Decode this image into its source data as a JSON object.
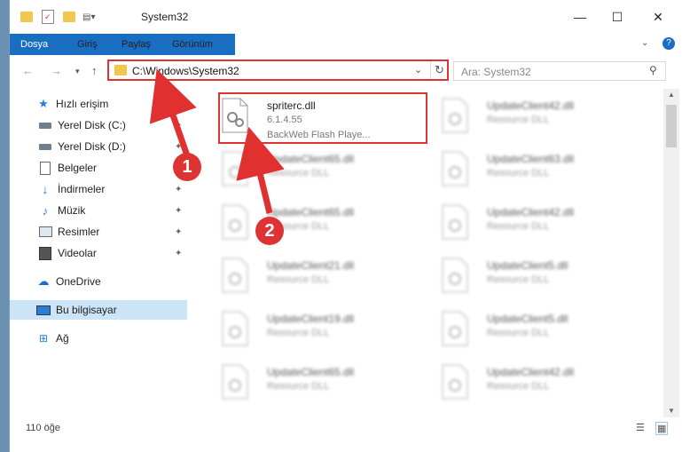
{
  "window": {
    "title": "System32",
    "minimize": "—",
    "maximize": "☐",
    "close": "✕"
  },
  "ribbon": {
    "tabs": [
      "Dosya",
      "Giriş",
      "Paylaş",
      "Görünüm"
    ]
  },
  "address": {
    "path": "C:\\Windows\\System32"
  },
  "search": {
    "placeholder": "Ara: System32"
  },
  "sidebar": {
    "items": [
      {
        "label": "Hızlı erişim",
        "icon": "star-icon"
      },
      {
        "label": "Yerel Disk (C:)",
        "icon": "drive-icon"
      },
      {
        "label": "Yerel Disk (D:)",
        "icon": "drive-icon"
      },
      {
        "label": "Belgeler",
        "icon": "documents-icon"
      },
      {
        "label": "İndirmeler",
        "icon": "downloads-icon"
      },
      {
        "label": "Müzik",
        "icon": "music-icon"
      },
      {
        "label": "Resimler",
        "icon": "pictures-icon"
      },
      {
        "label": "Videolar",
        "icon": "videos-icon"
      },
      {
        "label": "OneDrive",
        "icon": "cloud-icon"
      },
      {
        "label": "Bu bilgisayar",
        "icon": "computer-icon"
      },
      {
        "label": "Ağ",
        "icon": "network-icon"
      }
    ]
  },
  "files": [
    {
      "name": "spriterc.dll",
      "line2": "6.1.4.55",
      "line3": "BackWeb Flash Playe..."
    },
    {
      "name": "UpdateClient42.dll",
      "line2": "Resource DLL"
    },
    {
      "name": "UpdateClient65.dll",
      "line2": "Resource DLL"
    },
    {
      "name": "UpdateClient63.dll",
      "line2": "Resource DLL"
    },
    {
      "name": "UpdateClient65.dll",
      "line2": "Resource DLL"
    },
    {
      "name": "UpdateClient42.dll",
      "line2": "Resource DLL"
    },
    {
      "name": "UpdateClient21.dll",
      "line2": "Resource DLL"
    },
    {
      "name": "UpdateClient5.dll",
      "line2": "Resource DLL"
    },
    {
      "name": "UpdateClient19.dll",
      "line2": "Resource DLL"
    },
    {
      "name": "UpdateClient5.dll",
      "line2": "Resource DLL"
    },
    {
      "name": "UpdateClient65.dll",
      "line2": "Resource DLL"
    },
    {
      "name": "UpdateClient42.dll",
      "line2": "Resource DLL"
    }
  ],
  "status": {
    "count": "110 öğe"
  },
  "annotations": {
    "badge1": "1",
    "badge2": "2"
  },
  "colors": {
    "accent": "#1a6ec2",
    "highlight": "#dd3333",
    "selected": "#cce4f7"
  }
}
